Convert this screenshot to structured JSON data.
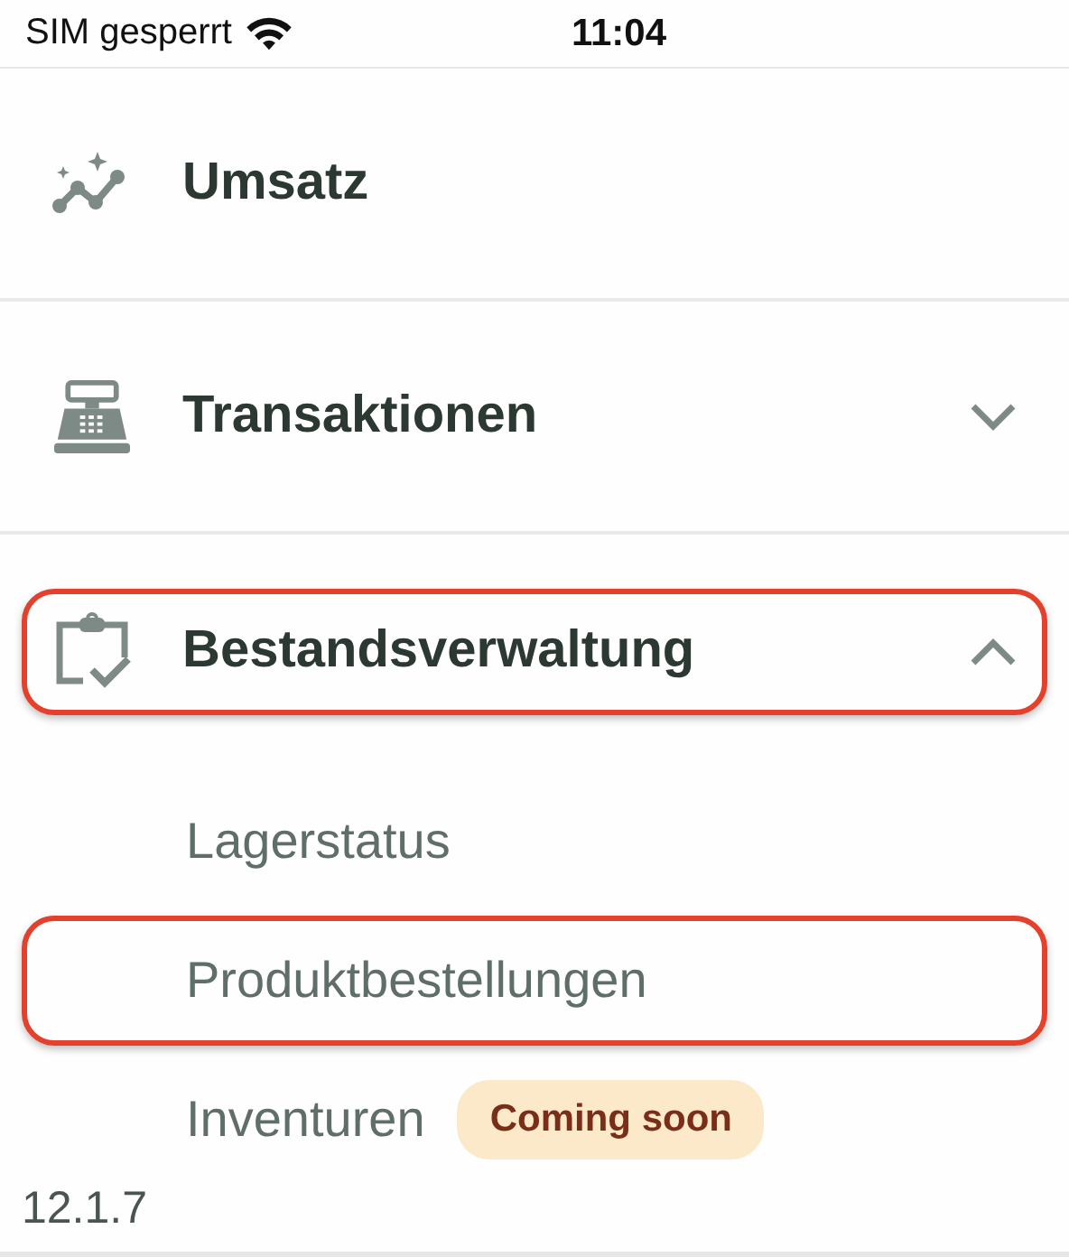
{
  "status_bar": {
    "carrier": "SIM gesperrt",
    "time": "11:04"
  },
  "menu": [
    {
      "kind": "link",
      "label": "Umsatz",
      "highlighted": false
    },
    {
      "kind": "group",
      "label": "Transaktionen",
      "expanded": false,
      "highlighted": false
    },
    {
      "kind": "group",
      "label": "Bestandsverwaltung",
      "expanded": true,
      "highlighted": true,
      "children": [
        {
          "label": "Lagerstatus",
          "highlighted": false
        },
        {
          "label": "Produktbestellungen",
          "highlighted": true
        },
        {
          "label": "Inventuren",
          "highlighted": false,
          "badge": "Coming soon"
        }
      ]
    }
  ],
  "version": "12.1.7"
}
